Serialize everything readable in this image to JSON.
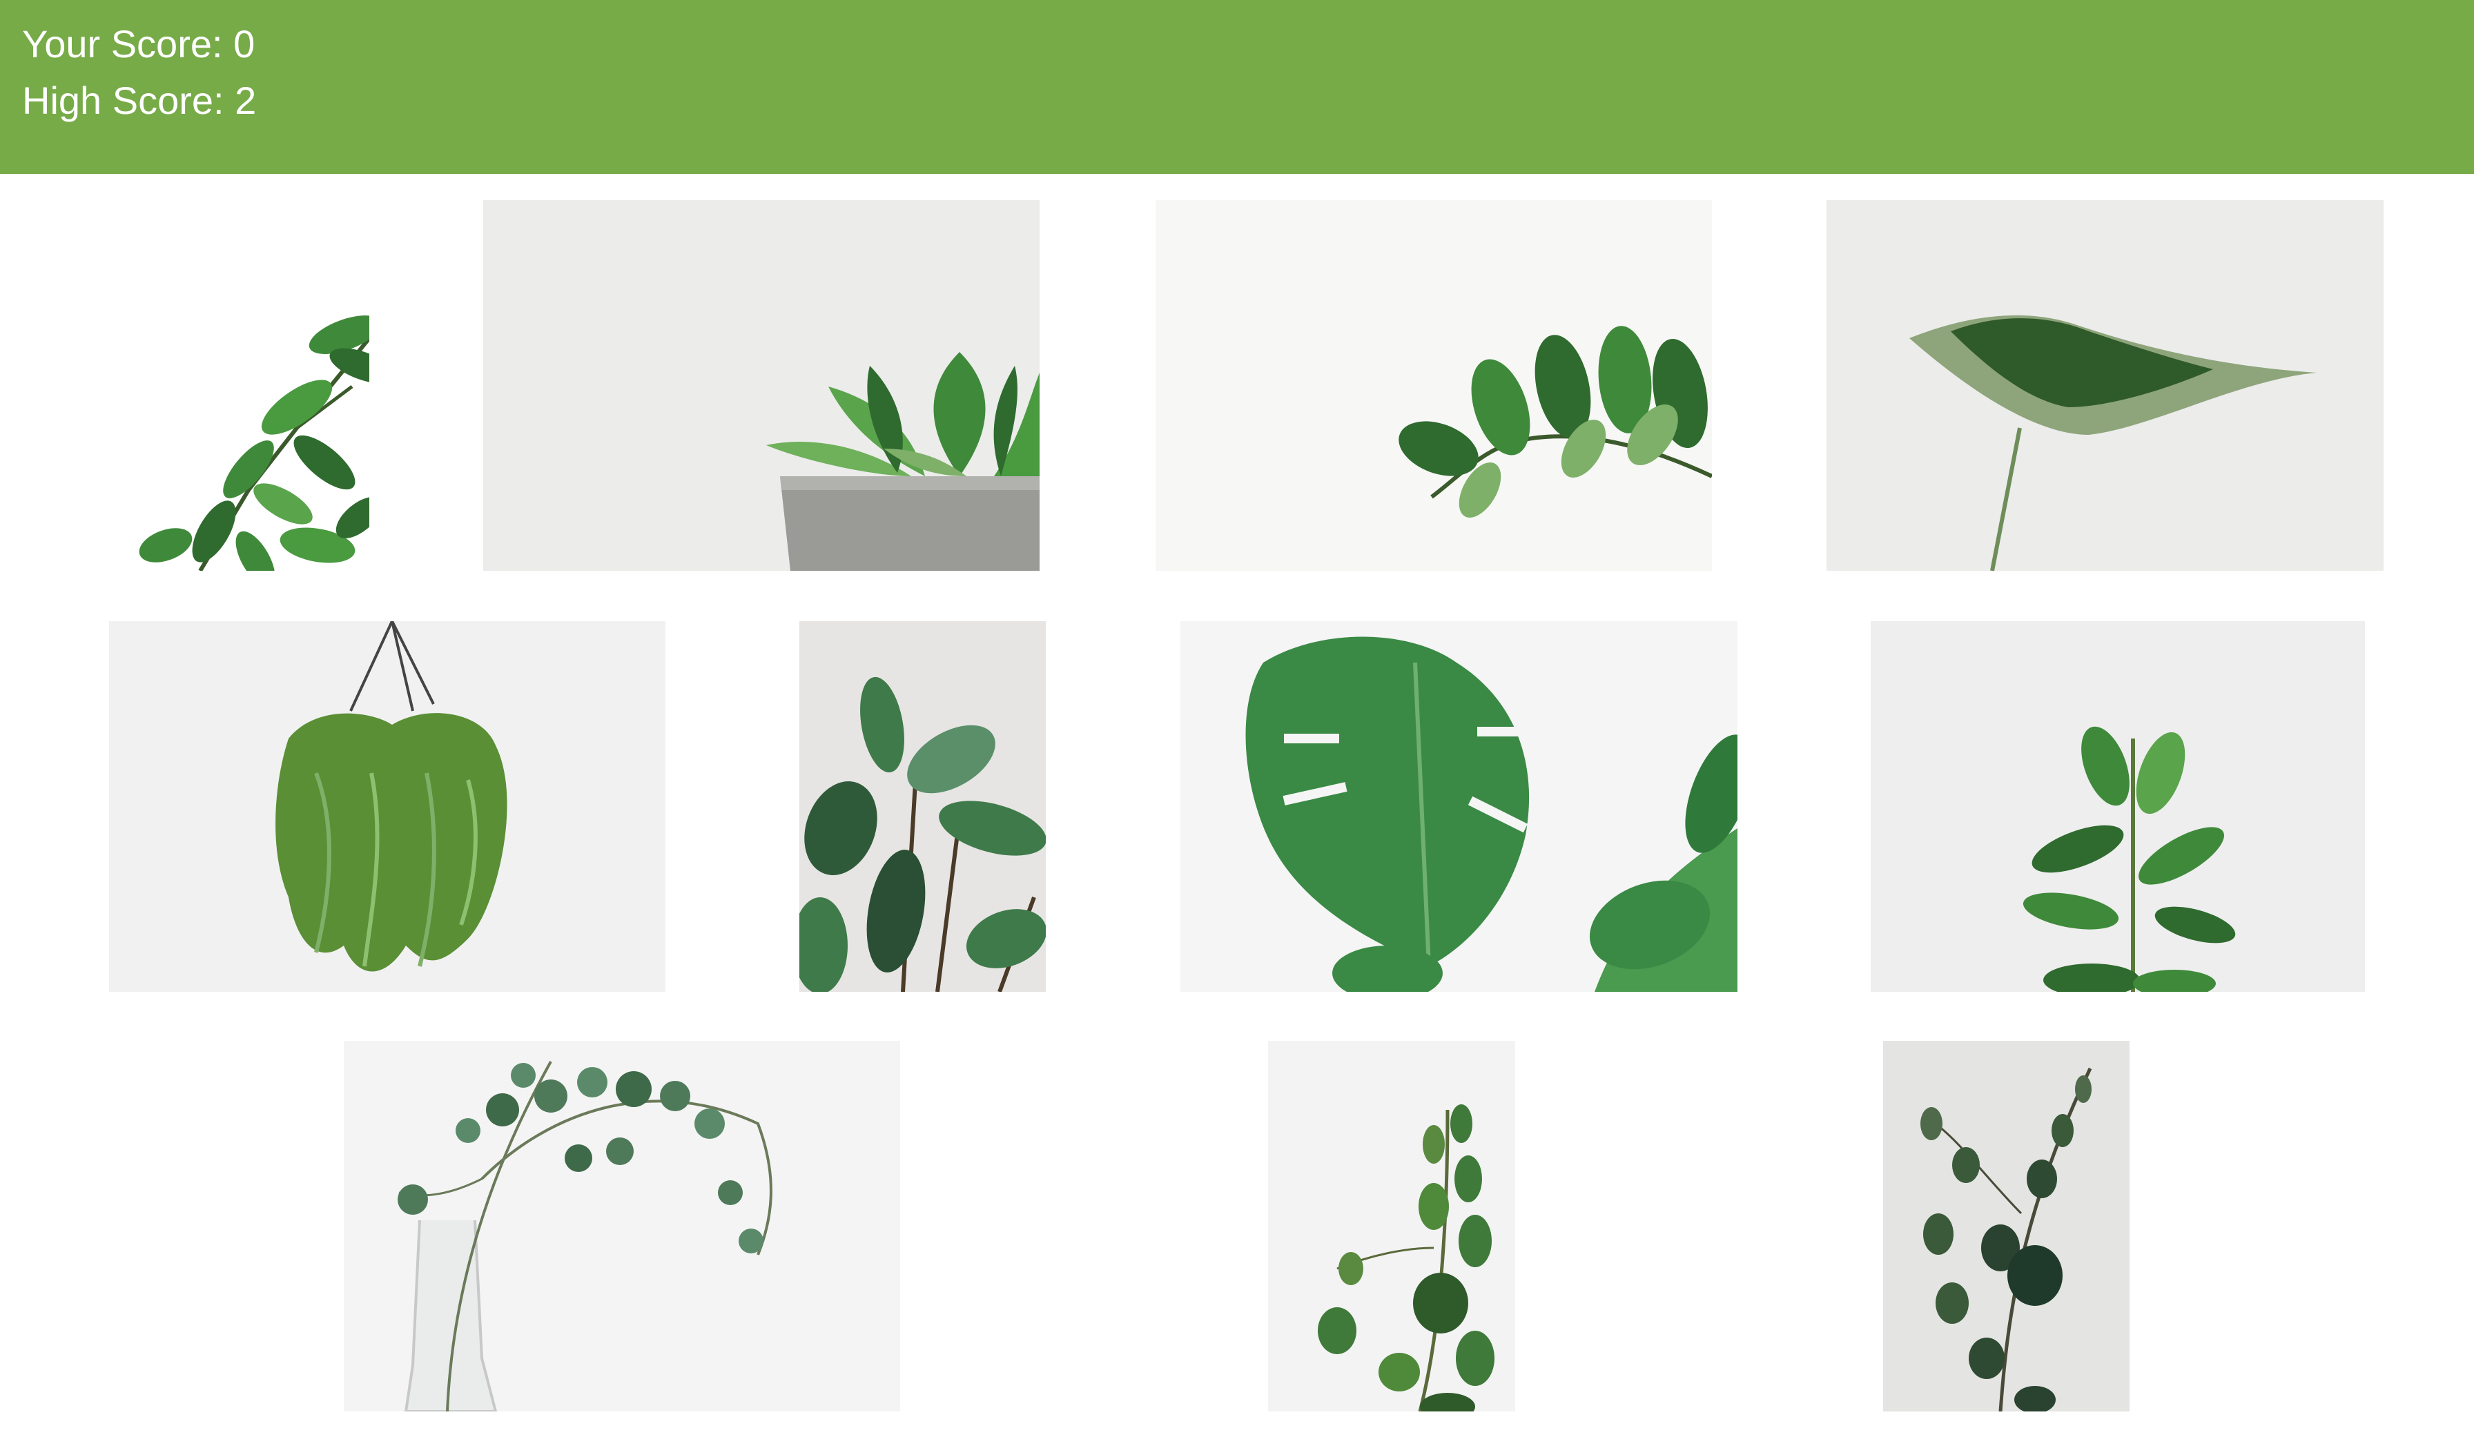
{
  "header": {
    "score_label": "Your Score: 0",
    "high_score_label": "High Score: 2",
    "background_color": "#77ab48",
    "text_color": "#ffffff"
  },
  "cards": [
    {
      "subject": "fig-leaf-branch"
    },
    {
      "subject": "succulent-in-concrete-pot"
    },
    {
      "subject": "zz-plant-stem"
    },
    {
      "subject": "single-anthurium-leaf"
    },
    {
      "subject": "hanging-fern-basket"
    },
    {
      "subject": "rubber-plant"
    },
    {
      "subject": "monstera-leaf"
    },
    {
      "subject": "ficus-seedling"
    },
    {
      "subject": "eucalyptus-in-glass-vase"
    },
    {
      "subject": "eucalyptus-sprig"
    },
    {
      "subject": "eucalyptus-branch-dark"
    }
  ],
  "colors": {
    "leaf_dark": "#2f6b2f",
    "leaf_mid": "#3f8a3a",
    "leaf_light": "#7fb069",
    "pot_grey": "#9a9a97"
  }
}
